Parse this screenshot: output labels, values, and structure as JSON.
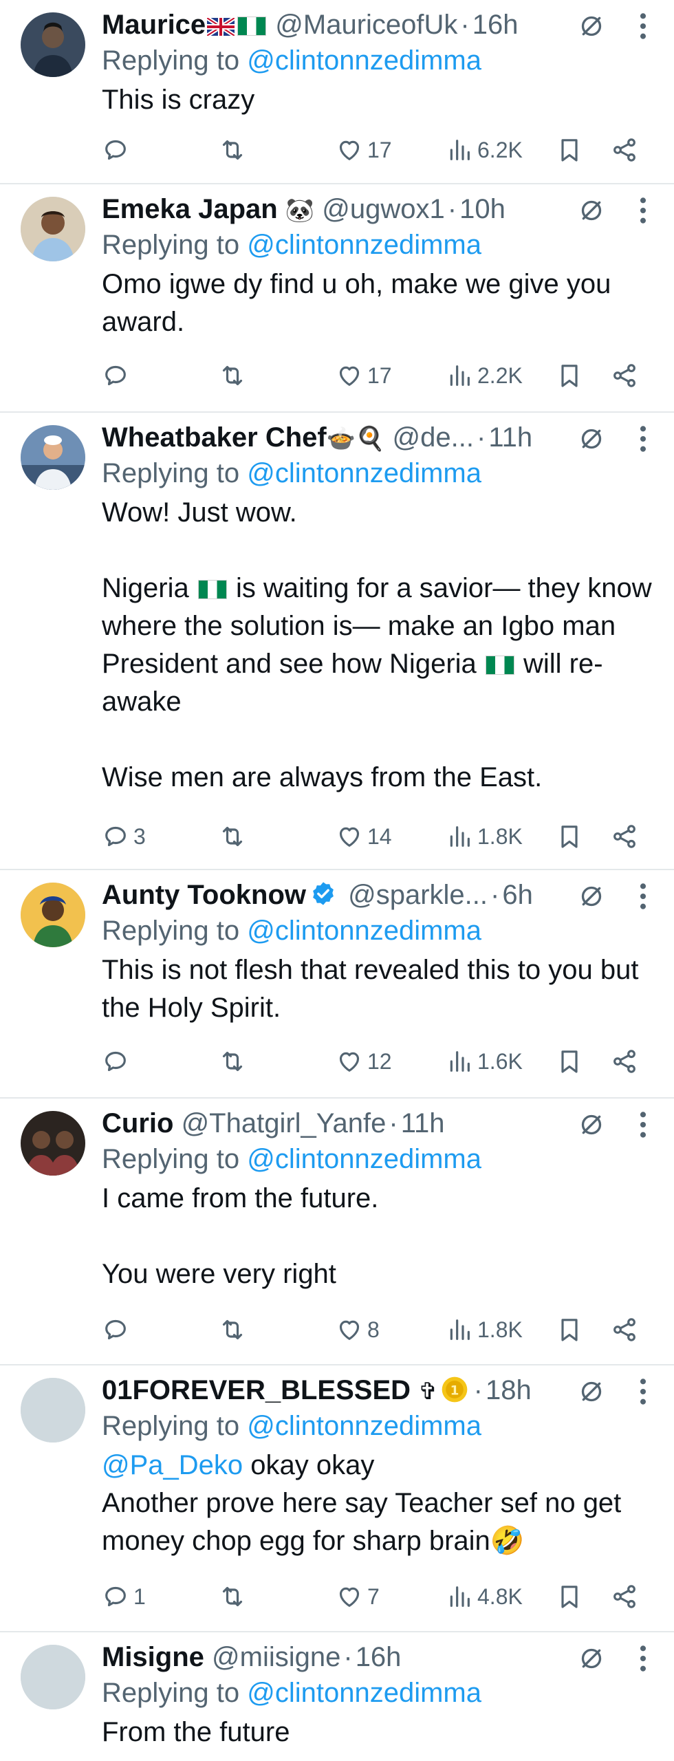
{
  "reply_prefix": "Replying to",
  "replying_to_handle": "@clintonnzedimma",
  "accent_color": "#1d9bf0",
  "tweets": [
    {
      "name": "Maurice",
      "name_badges": [
        "uk-flag",
        "nigeria-flag"
      ],
      "handle": "@MauriceofUk",
      "dot": "·",
      "time": "16h",
      "body": [
        "This is crazy"
      ],
      "reply_count": "",
      "like_count": "17",
      "view_count": "6.2K"
    },
    {
      "name": "Emeka Japan",
      "name_emoji": "🐼",
      "handle": "@ugwox1",
      "dot": "·",
      "time": "10h",
      "body": [
        "Omo igwe dy find u oh, make we give you award."
      ],
      "reply_count": "",
      "like_count": "17",
      "view_count": "2.2K"
    },
    {
      "name": "Wheatbaker Chef",
      "name_emoji": "🍲🍳",
      "handle": "@de...",
      "dot": "·",
      "time": "11h",
      "body_l1": "Wow! Just wow.",
      "body_l2a": "Nigeria",
      "body_l2b": "is waiting for a savior— they know where the solution is— make an Igbo man President and see how Nigeria",
      "body_l2c": "will re-awake",
      "body_l3": "Wise men are always from the East.",
      "reply_count": "3",
      "like_count": "14",
      "view_count": "1.8K"
    },
    {
      "name": "Aunty Tooknow",
      "verified": true,
      "handle": "@sparkle...",
      "dot": "·",
      "time": "6h",
      "body": [
        "This is not flesh that revealed this to you but the Holy Spirit."
      ],
      "reply_count": "",
      "like_count": "12",
      "view_count": "1.6K"
    },
    {
      "name": "Curio",
      "handle": "@Thatgirl_Yanfe",
      "dot": "·",
      "time": "11h",
      "body": [
        "I came from the future.",
        "",
        "You were very right"
      ],
      "reply_count": "",
      "like_count": "8",
      "view_count": "1.8K"
    },
    {
      "name": "01FOREVER_BLESSED",
      "name_emoji": "✞",
      "handle": "",
      "dot": "·",
      "time": "18h",
      "body_mention": "@Pa_Deko",
      "body_l1": "okay okay",
      "body_l2": "Another prove here say Teacher sef no get money chop egg for sharp brain🤣",
      "reply_count": "1",
      "like_count": "7",
      "view_count": "4.8K"
    },
    {
      "name": "Misigne",
      "handle": "@miisigne",
      "dot": "·",
      "time": "16h",
      "body": [
        "From the future"
      ]
    }
  ]
}
